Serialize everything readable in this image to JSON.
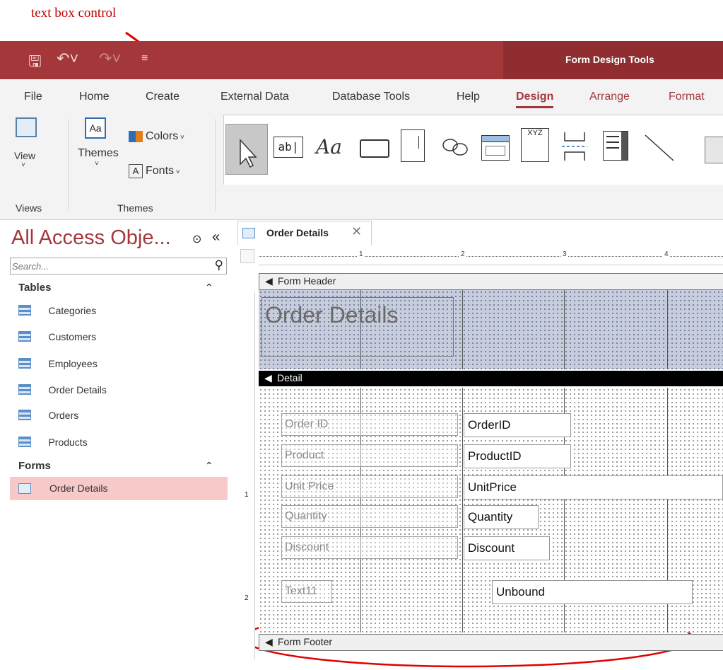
{
  "annotation": {
    "text": "text box control",
    "color": "#c00000"
  },
  "title_bar": {
    "context_label": "Form Design Tools",
    "accent": "#a4373a"
  },
  "ribbon_tabs": [
    "File",
    "Home",
    "Create",
    "External Data",
    "Database Tools",
    "Help",
    "Design",
    "Arrange",
    "Format"
  ],
  "ribbon": {
    "view_label": "View",
    "themes_label": "Themes",
    "colors_label": "Colors",
    "fonts_label": "Fonts",
    "group_views": "Views",
    "group_themes": "Themes",
    "label_control_text": "Aa",
    "combo_text": "XYZ",
    "textbox_icon_text": "ab|"
  },
  "nav": {
    "title": "All Access Obje...",
    "search_placeholder": "Search...",
    "tables_header": "Tables",
    "tables": [
      "Categories",
      "Customers",
      "Employees",
      "Order Details",
      "Orders",
      "Products"
    ],
    "forms_header": "Forms",
    "forms": [
      "Order Details"
    ]
  },
  "document": {
    "tab_title": "Order Details",
    "ruler_numbers": [
      "1",
      "2",
      "3",
      "4"
    ],
    "form_header_label": "Form Header",
    "header_title": "Order Details",
    "detail_label": "Detail",
    "form_footer_label": "Form Footer",
    "vertical_ruler": [
      "1",
      "2"
    ],
    "fields": [
      {
        "label": "Order ID",
        "control": "OrderID"
      },
      {
        "label": "Product",
        "control": "ProductID"
      },
      {
        "label": "Unit Price",
        "control": "UnitPrice"
      },
      {
        "label": "Quantity",
        "control": "Quantity"
      },
      {
        "label": "Discount",
        "control": "Discount"
      },
      {
        "label": "Text11",
        "control": "Unbound"
      }
    ]
  }
}
